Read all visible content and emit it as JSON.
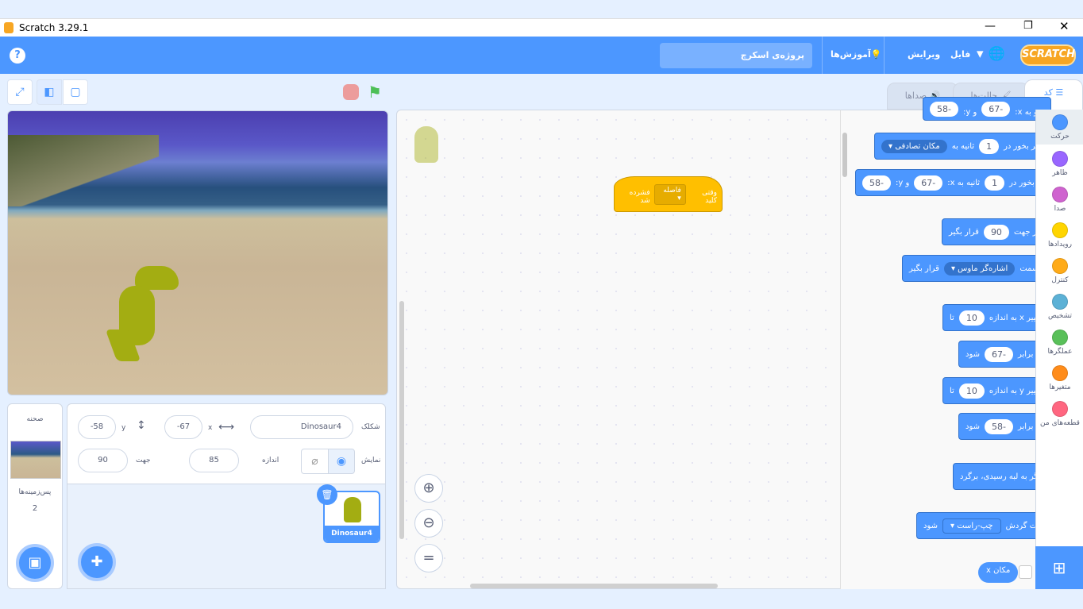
{
  "window": {
    "title": "Scratch 3.29.1"
  },
  "menubar": {
    "logo": "SCRATCH",
    "file": "فایل",
    "edit": "ویرایش",
    "tutorials": "آموزش‌ها",
    "project_title": "پروژه‌ی اسکرچ",
    "help": "?"
  },
  "tabs": {
    "code": "کد",
    "costumes": "حالت‌ها",
    "sounds": "صداها"
  },
  "categories": [
    {
      "label": "حرکت",
      "color": "#4c97ff"
    },
    {
      "label": "ظاهر",
      "color": "#9966ff"
    },
    {
      "label": "صدا",
      "color": "#cf63cf"
    },
    {
      "label": "رویدادها",
      "color": "#ffd500"
    },
    {
      "label": "کنترل",
      "color": "#ffab19"
    },
    {
      "label": "تشخیص",
      "color": "#5cb1d6"
    },
    {
      "label": "عملگرها",
      "color": "#59c059"
    },
    {
      "label": "متغیرها",
      "color": "#ff8c1a"
    },
    {
      "label": "قطعه‌های من",
      "color": "#ff6680"
    }
  ],
  "blocks": {
    "goto_xy": {
      "a": "برو به x:",
      "x": "-67",
      "b": "و y:",
      "y": "-58"
    },
    "glide_random": {
      "a": "سُر بخور در",
      "secs": "1",
      "b": "ثانیه به",
      "target": "مکان تصادفی"
    },
    "glide_xy": {
      "a": "سُر بخور در",
      "secs": "1",
      "b": "ثانیه به x:",
      "x": "-67",
      "c": "و y:",
      "y": "-58"
    },
    "point_dir": {
      "a": "در جهت",
      "val": "90",
      "b": "قرار بگیر"
    },
    "point_towards": {
      "a": "به سمت",
      "target": "اشاره‌گر ماوس",
      "b": "قرار بگیر"
    },
    "change_x": {
      "a": "تغییر x به اندازه",
      "val": "10",
      "b": "تا"
    },
    "set_x": {
      "a": "x برابر",
      "val": "-67",
      "b": "شود"
    },
    "change_y": {
      "a": "تغییر y به اندازه",
      "val": "10",
      "b": "تا"
    },
    "set_y": {
      "a": "y برابر",
      "val": "-58",
      "b": "شود"
    },
    "bounce": {
      "a": "اگر به لبه رسیدی، برگرد"
    },
    "rotation": {
      "a": "حالت گردش",
      "val": "چپ‌-راست",
      "b": "شود"
    },
    "xpos": {
      "a": "مکان x"
    }
  },
  "script": {
    "hat_a": "وقتی کلید",
    "key": "فاصله",
    "hat_b": "فشرده شد"
  },
  "sprite": {
    "label": "شکلک",
    "name": "Dinosaur4",
    "x_label": "x",
    "x": "-67",
    "y_label": "y",
    "y": "-58",
    "show_label": "نمایش",
    "size_label": "اندازه",
    "size": "85",
    "dir_label": "جهت",
    "direction": "90"
  },
  "sprites": [
    {
      "name": "Dinosaur4"
    }
  ],
  "stage_pane": {
    "title": "صحنه",
    "backdrops_label": "پس‌زمینه‌ها",
    "backdrops_count": "2"
  }
}
